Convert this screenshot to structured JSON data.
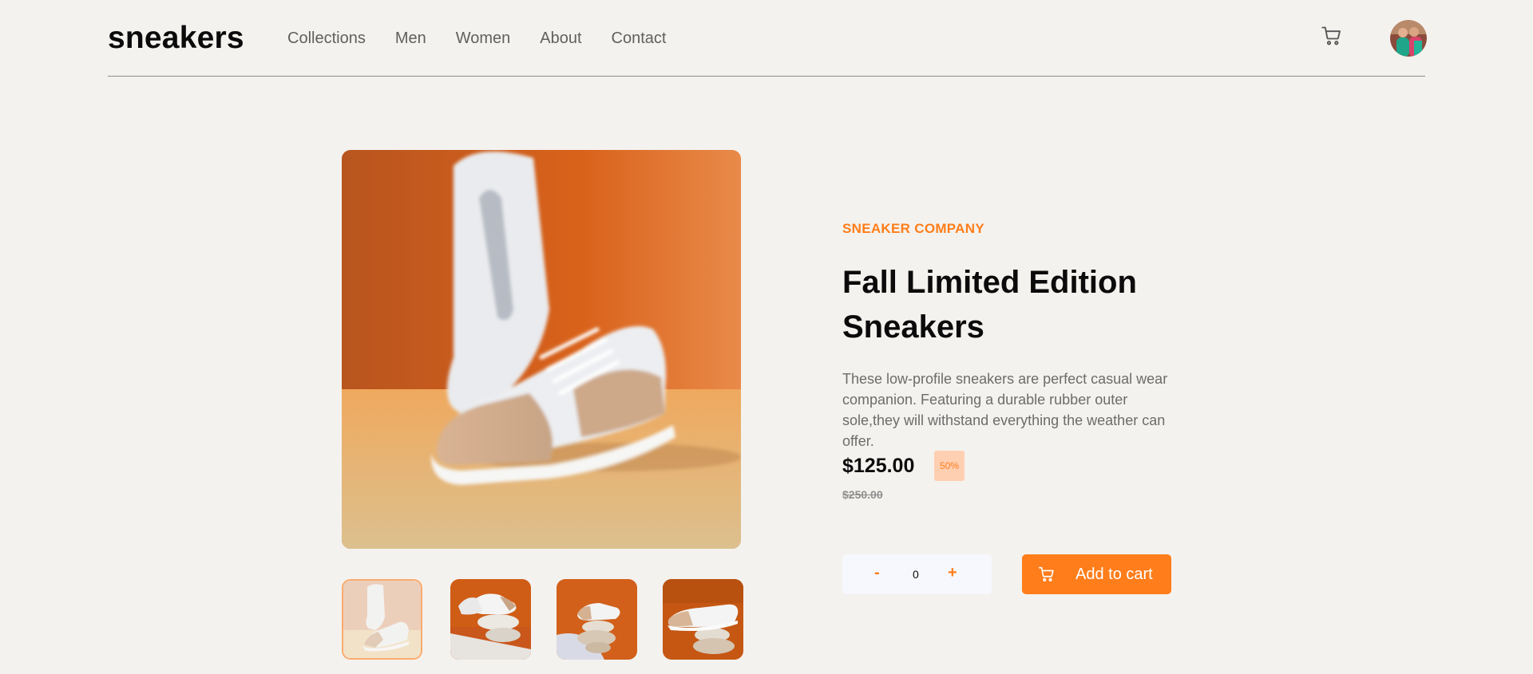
{
  "header": {
    "logo": "sneakers",
    "nav": [
      "Collections",
      "Men",
      "Women",
      "About",
      "Contact"
    ],
    "cart_icon": "cart-icon",
    "avatar_icon": "avatar"
  },
  "gallery": {
    "main_image": "white sneaker on orange background",
    "thumbnails": [
      "white sneaker standing on beige",
      "sneakers on stones orange background",
      "sneaker balanced on stones",
      "sneaker on stacked stones"
    ],
    "active_thumbnail": 1
  },
  "product": {
    "company": "SNEAKER COMPANY",
    "title": "Fall Limited Edition Sneakers",
    "description": "These low-profile sneakers are perfect casual wear companion. Featuring a durable rubber outer sole,they will withstand everything the weather can offer.",
    "price": "$125.00",
    "discount": "50%",
    "old_price": "$250.00"
  },
  "cart_controls": {
    "minus": "-",
    "quantity": "0",
    "plus": "+",
    "add_to_cart": "Add to cart"
  },
  "colors": {
    "accent": "#ff7d1a",
    "accent_pale": "#ffcfb2",
    "background": "#f4f2ee"
  }
}
